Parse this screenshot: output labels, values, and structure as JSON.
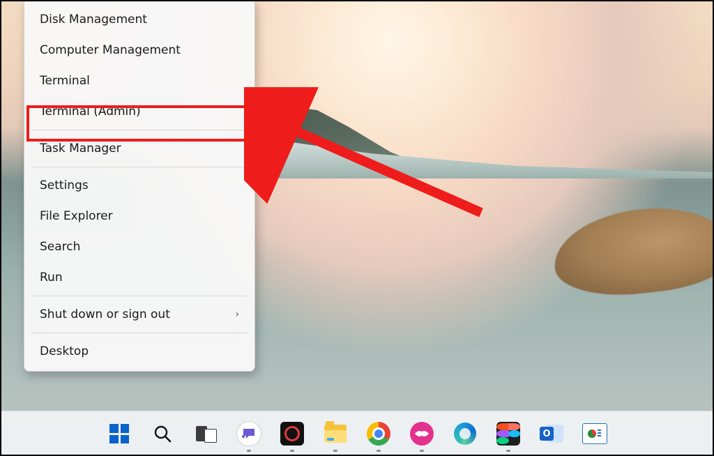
{
  "menu": {
    "items": [
      {
        "label": "Disk Management",
        "submenu": false
      },
      {
        "label": "Computer Management",
        "submenu": false
      },
      {
        "label": "Terminal",
        "submenu": false
      },
      {
        "label": "Terminal (Admin)",
        "submenu": false
      },
      {
        "sep": true
      },
      {
        "label": "Task Manager",
        "submenu": false
      },
      {
        "sep": true
      },
      {
        "label": "Settings",
        "submenu": false
      },
      {
        "label": "File Explorer",
        "submenu": false
      },
      {
        "label": "Search",
        "submenu": false
      },
      {
        "label": "Run",
        "submenu": false
      },
      {
        "sep": true
      },
      {
        "label": "Shut down or sign out",
        "submenu": true
      },
      {
        "sep": true
      },
      {
        "label": "Desktop",
        "submenu": false
      }
    ],
    "highlighted_index": 3
  },
  "taskbar": {
    "icons": [
      {
        "name": "start",
        "running": false
      },
      {
        "name": "search",
        "running": false
      },
      {
        "name": "task-view",
        "running": false
      },
      {
        "name": "chat",
        "running": true
      },
      {
        "name": "screen-recorder",
        "running": true
      },
      {
        "name": "file-explorer",
        "running": true
      },
      {
        "name": "chrome",
        "running": true
      },
      {
        "name": "lips-app",
        "running": true
      },
      {
        "name": "edge",
        "running": false
      },
      {
        "name": "figma",
        "running": true
      },
      {
        "name": "outlook",
        "running": false
      },
      {
        "name": "chart-app",
        "running": false
      }
    ]
  },
  "colors": {
    "highlight": "#ef1c1c",
    "win_blue": "#0a63c9"
  }
}
